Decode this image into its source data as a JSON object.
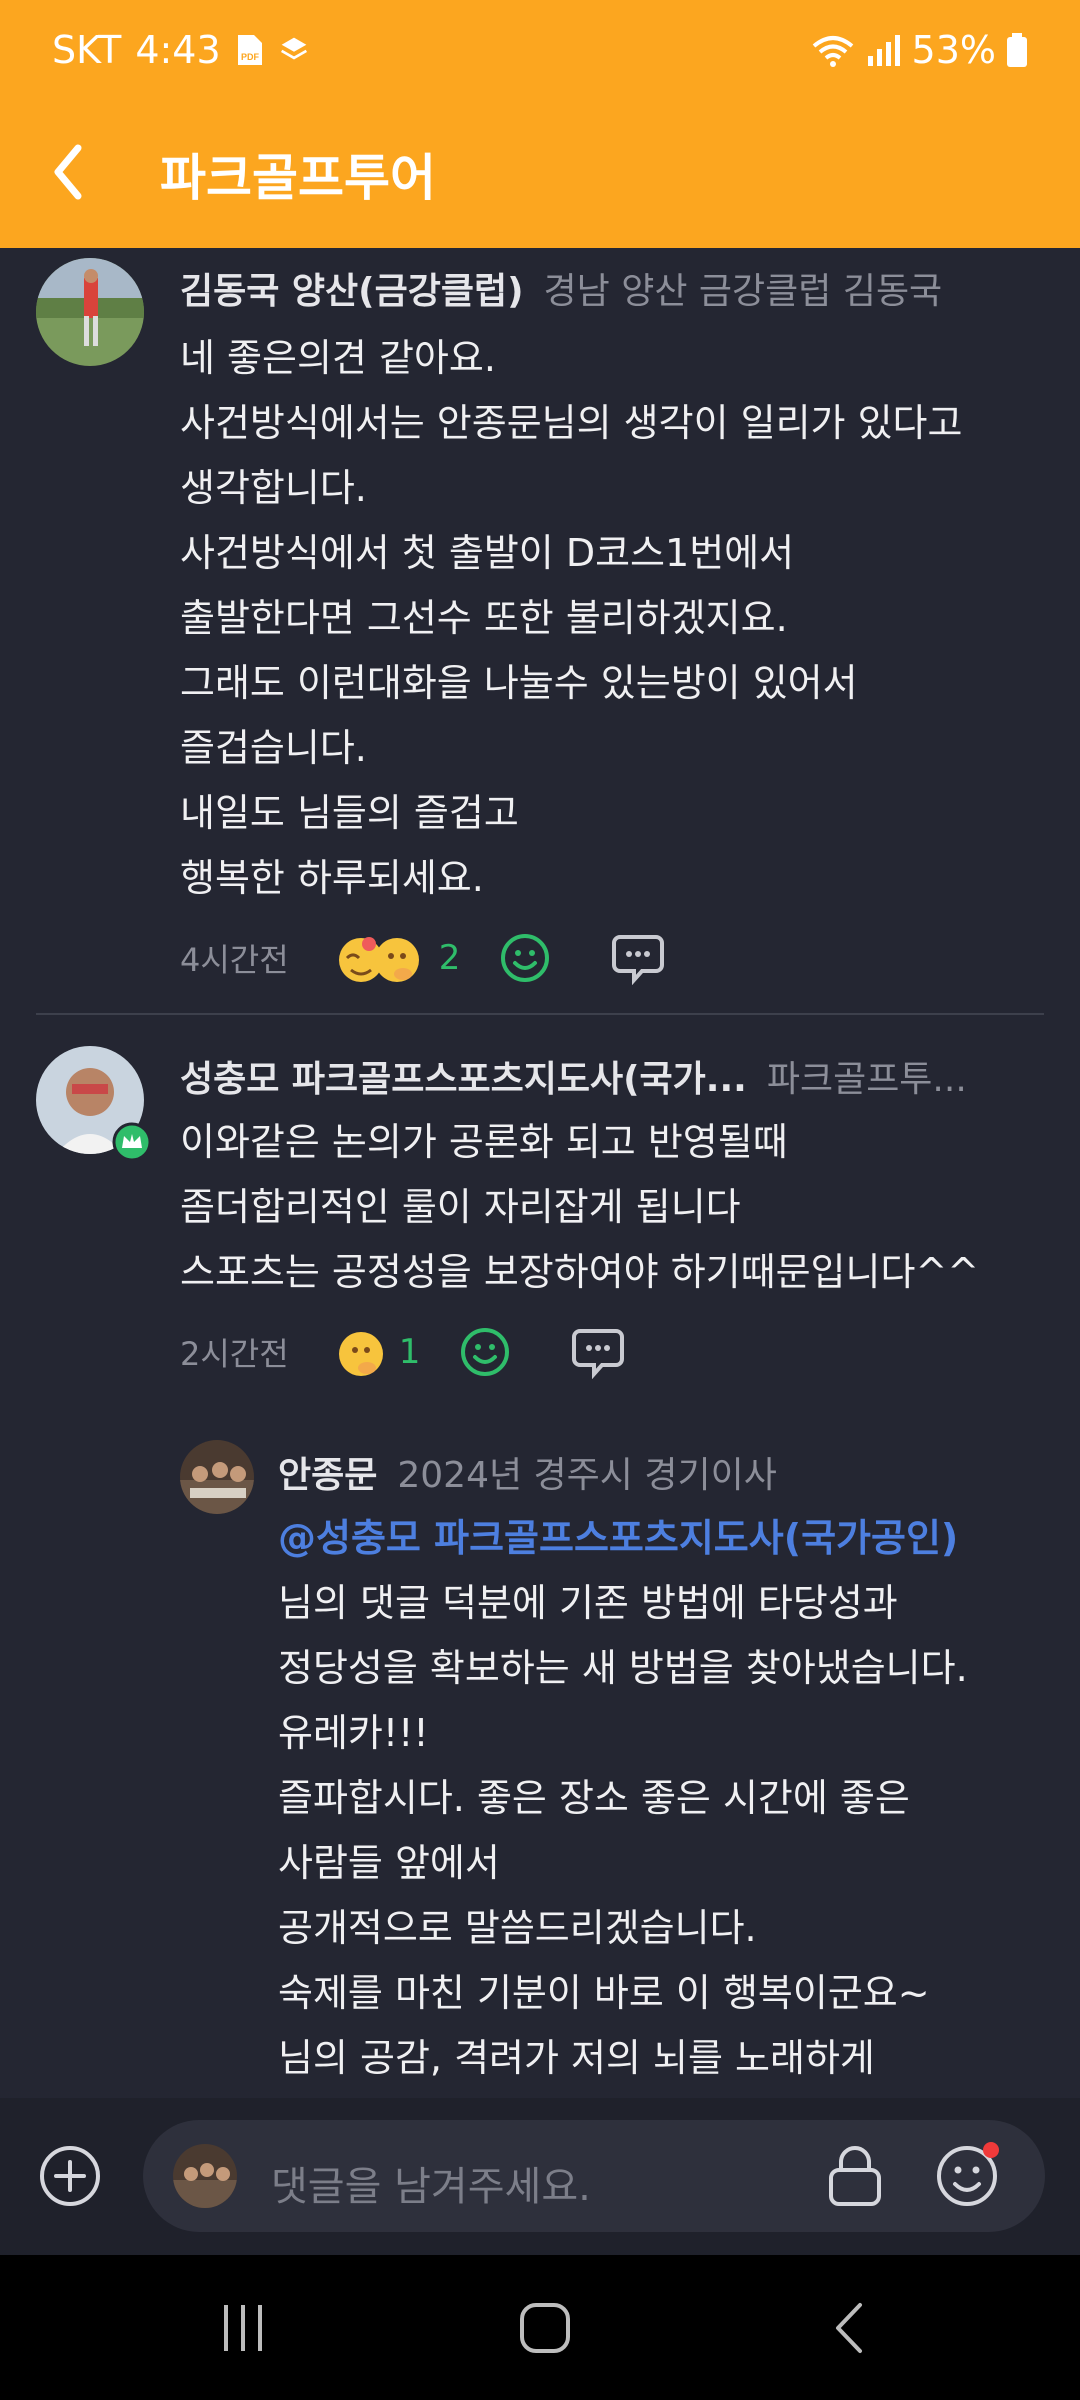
{
  "status_bar": {
    "carrier": "SKT",
    "time": "4:43",
    "battery": "53%"
  },
  "header": {
    "title": "파크골프투어"
  },
  "comments": [
    {
      "author": "김동국 양산(금강클럽)",
      "meta": "경남 양산 금강클럽 김동국",
      "body": "네 좋은의견 같아요.\n사건방식에서는 안종문님의 생각이 일리가 있다고\n생각합니다.\n사건방식에서 첫 출발이 D코스1번에서\n출발한다면 그선수 또한 불리하겠지요.\n그래도 이런대화을 나눌수 있는방이 있어서\n즐겁습니다.\n내일도 님들의 즐겁고\n행복한 하루되세요.",
      "time": "4시간전",
      "reaction_count": "2"
    },
    {
      "author": "성충모 파크골프스포츠지도사(국가...",
      "meta": "파크골프투...",
      "body": "이와같은 논의가 공론화 되고 반영될때\n좀더합리적인 룰이 자리잡게 됩니다\n스포츠는 공정성을 보장하여야 하기때문입니다^^",
      "time": "2시간전",
      "reaction_count": "1"
    }
  ],
  "reply": {
    "author": "안종문",
    "meta": "2024년 경주시 경기이사",
    "mention": "@성충모 파크골프스포츠지도사(국가공인)",
    "body": "님의 댓글 덕분에  기존 방법에 타당성과\n정당성을 확보하는 새 방법을 찾아냈습니다.\n유레카!!!\n즐파합시다. 좋은 장소  좋은 시간에 좋은\n사람들 앞에서\n공개적으로 말씀드리겠습니다.\n숙제를 마친 기분이 바로 이 행복이군요~\n님의 공감,  격려가 저의 뇌를 노래하게"
  },
  "input": {
    "placeholder": "댓글을 남겨주세요."
  },
  "colors": {
    "header": "#fca61f",
    "background": "#242632",
    "mention": "#4d7fe0",
    "reaction": "#2fbd6a"
  },
  "icons": [
    "back-icon",
    "add-icon",
    "lock-icon",
    "emoji-icon",
    "comment-icon",
    "smile-icon"
  ]
}
